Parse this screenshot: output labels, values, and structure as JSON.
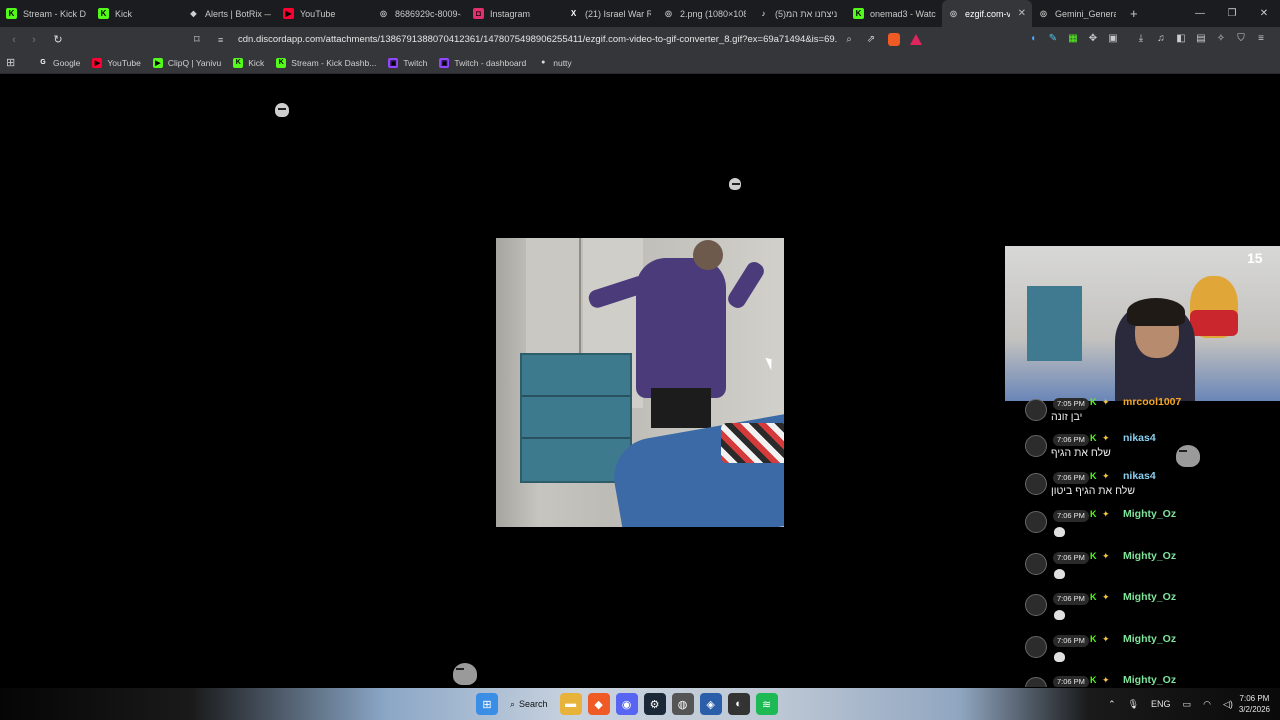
{
  "browser": {
    "tabs": [
      {
        "title": "Stream - Kick Da",
        "icon": "kick-icon",
        "color": "#53fc18",
        "glyph": "K"
      },
      {
        "title": "Kick",
        "icon": "kick-icon",
        "color": "#53fc18",
        "glyph": "K"
      },
      {
        "title": "Alerts | BotRix —",
        "icon": "botrix-icon",
        "color": "#d0d0d0",
        "glyph": "◆"
      },
      {
        "title": "YouTube",
        "icon": "youtube-icon",
        "color": "#ff0033",
        "glyph": "▶"
      },
      {
        "title": "8686929c-8009-4",
        "icon": "globe-icon",
        "color": "#bbbbbb",
        "glyph": "◎"
      },
      {
        "title": "Instagram",
        "icon": "instagram-icon",
        "color": "#e1306c",
        "glyph": "◘"
      },
      {
        "title": "(21) Israel War Ro",
        "icon": "x-icon",
        "color": "#ffffff",
        "glyph": "X"
      },
      {
        "title": "2.png (1080×108",
        "icon": "globe-icon",
        "color": "#bbbbbb",
        "glyph": "◎"
      },
      {
        "title": "(5)ניצחנו את המ",
        "icon": "tiktok-icon",
        "color": "#ffffff",
        "glyph": "♪"
      },
      {
        "title": "onemad3 - Watc",
        "icon": "kick-icon",
        "color": "#53fc18",
        "glyph": "K"
      },
      {
        "title": "ezgif.com-vi",
        "icon": "globe-icon",
        "color": "#bbbbbb",
        "glyph": "◎",
        "active": true
      },
      {
        "title": "Gemini_Generat",
        "icon": "globe-icon",
        "color": "#bbbbbb",
        "glyph": "◎"
      }
    ],
    "new_tab": "+",
    "window_controls": [
      "—",
      "❐",
      "✕"
    ],
    "url": "cdn.discordapp.com/attachments/1386791388070412361/1478075498906255411/ezgif.com-video-to-gif-converter_8.gif?ex=69a71494&is=69...",
    "bookmarks": [
      {
        "label": "Google",
        "icon": "google-icon",
        "color": "#ffffff",
        "glyph": "G"
      },
      {
        "label": "YouTube",
        "icon": "youtube-icon",
        "color": "#ff0033",
        "glyph": "▶"
      },
      {
        "label": "ClipQ | Yanivu",
        "icon": "clipq-icon",
        "color": "#53fc18",
        "glyph": "▶"
      },
      {
        "label": "Kick",
        "icon": "kick-icon",
        "color": "#53fc18",
        "glyph": "K"
      },
      {
        "label": "Stream - Kick Dashb...",
        "icon": "kick-icon",
        "color": "#53fc18",
        "glyph": "K"
      },
      {
        "label": "Twitch",
        "icon": "twitch-icon",
        "color": "#9146ff",
        "glyph": "▣"
      },
      {
        "label": "Twitch - dashboard",
        "icon": "twitch-icon",
        "color": "#9146ff",
        "glyph": "▣"
      },
      {
        "label": "nutty",
        "icon": "nutty-icon",
        "color": "#dddddd",
        "glyph": "●"
      }
    ]
  },
  "stream": {
    "webcam_badge": "15",
    "chat": [
      {
        "time": "7:05 PM",
        "user": "mrcool1007",
        "text": "יבן זונה",
        "user_color": "#f5a623"
      },
      {
        "time": "7:06 PM",
        "user": "nikas4",
        "text": "שלח את הגיף",
        "user_color": "#8ad1f0"
      },
      {
        "time": "7:06 PM",
        "user": "nikas4",
        "text": "שלח את הגיף ביטון",
        "user_color": "#8ad1f0"
      },
      {
        "time": "7:06 PM",
        "user": "Mighty_Oz",
        "text": "",
        "user_color": "#7fe39b"
      },
      {
        "time": "7:06 PM",
        "user": "Mighty_Oz",
        "text": "",
        "user_color": "#7fe39b"
      },
      {
        "time": "7:06 PM",
        "user": "Mighty_Oz",
        "text": "",
        "user_color": "#7fe39b"
      },
      {
        "time": "7:06 PM",
        "user": "Mighty_Oz",
        "text": "",
        "user_color": "#7fe39b"
      },
      {
        "time": "7:06 PM",
        "user": "Mighty_Oz",
        "text": "",
        "user_color": "#7fe39b"
      }
    ]
  },
  "taskbar": {
    "search_label": "Search",
    "language": "ENG",
    "time": "7:06 PM",
    "date": "3/2/2026"
  }
}
